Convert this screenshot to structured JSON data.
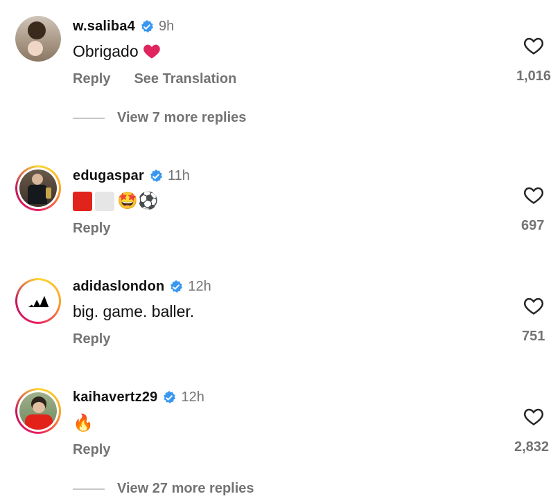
{
  "comments": [
    {
      "username": "w.saliba4",
      "time": "9h",
      "text": "Obrigado",
      "emoji": "❤️",
      "actions": [
        "Reply",
        "See Translation"
      ],
      "likes": "1,016",
      "view_replies": "View 7 more replies"
    },
    {
      "username": "edugaspar",
      "time": "11h",
      "text": "",
      "emoji": "🤩⚽",
      "actions": [
        "Reply"
      ],
      "likes": "697"
    },
    {
      "username": "adidaslondon",
      "time": "12h",
      "text": "big. game. baller.",
      "actions": [
        "Reply"
      ],
      "likes": "751"
    },
    {
      "username": "kaihavertz29",
      "time": "12h",
      "text": "",
      "emoji": "🔥",
      "actions": [
        "Reply"
      ],
      "likes": "2,832",
      "view_replies": "View 27 more replies"
    }
  ],
  "colors": {
    "verified": "#3897f0",
    "muted": "#737373",
    "heart": "#e0245e"
  }
}
